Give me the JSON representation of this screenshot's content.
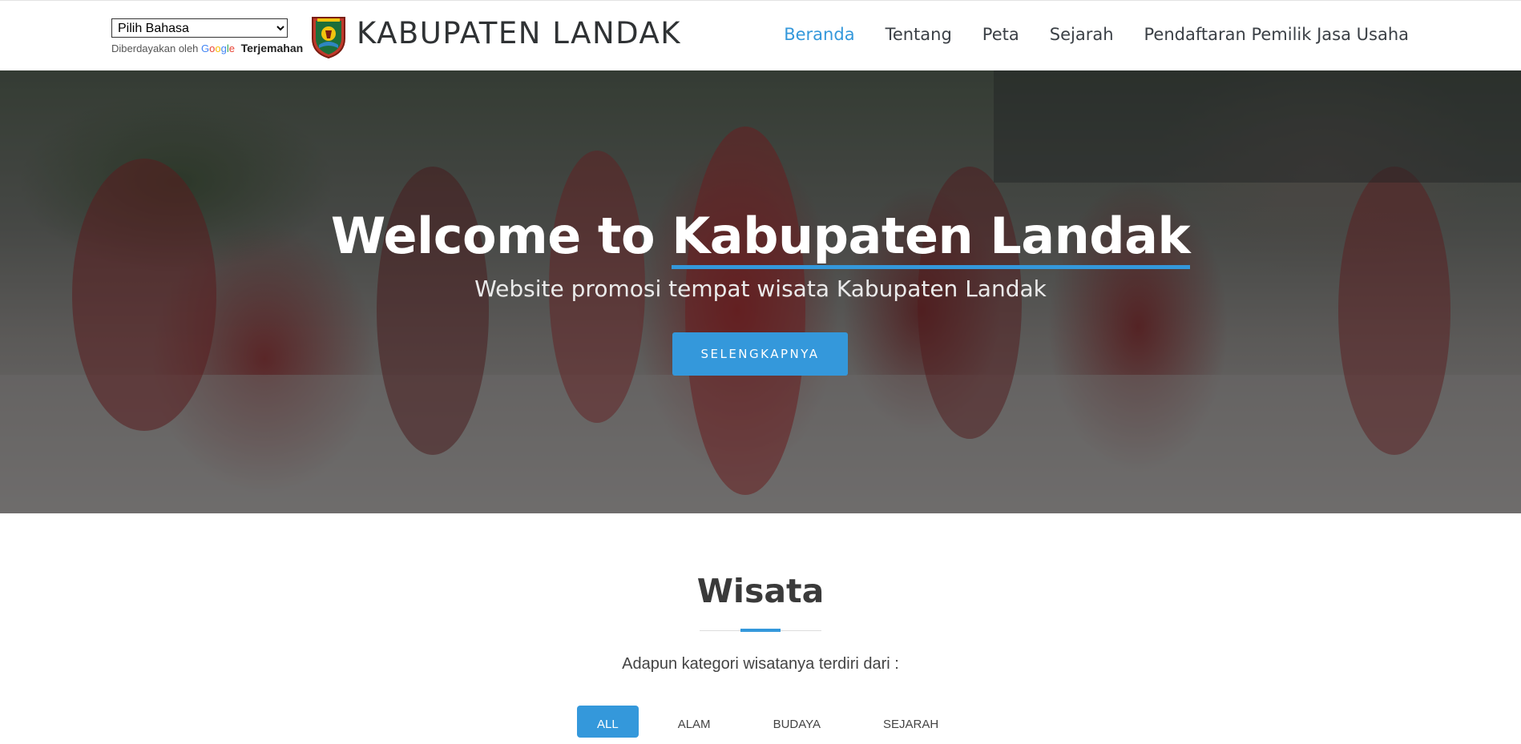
{
  "translate": {
    "select_value": "Pilih Bahasa",
    "powered_by": "Diberdayakan oleh",
    "google_word": "Google",
    "translate_label": "Terjemahan"
  },
  "brand": {
    "name": "KABUPATEN LANDAK"
  },
  "nav": {
    "items": [
      {
        "label": "Beranda"
      },
      {
        "label": "Tentang"
      },
      {
        "label": "Peta"
      },
      {
        "label": "Sejarah"
      },
      {
        "label": "Pendaftaran Pemilik Jasa Usaha"
      }
    ]
  },
  "hero": {
    "title_prefix": "Welcome to",
    "title_highlight": "Kabupaten Landak",
    "subtitle": "Website promosi tempat wisata Kabupaten Landak",
    "button_label": "SELENGKAPNYA"
  },
  "wisata": {
    "title": "Wisata",
    "description": "Adapun kategori wisatanya terdiri dari :",
    "filters": [
      {
        "label": "ALL"
      },
      {
        "label": "ALAM"
      },
      {
        "label": "BUDAYA"
      },
      {
        "label": "SEJARAH"
      }
    ]
  },
  "colors": {
    "accent": "#3498db",
    "brand_text": "#2f3234",
    "nav_text": "#3b4046"
  }
}
